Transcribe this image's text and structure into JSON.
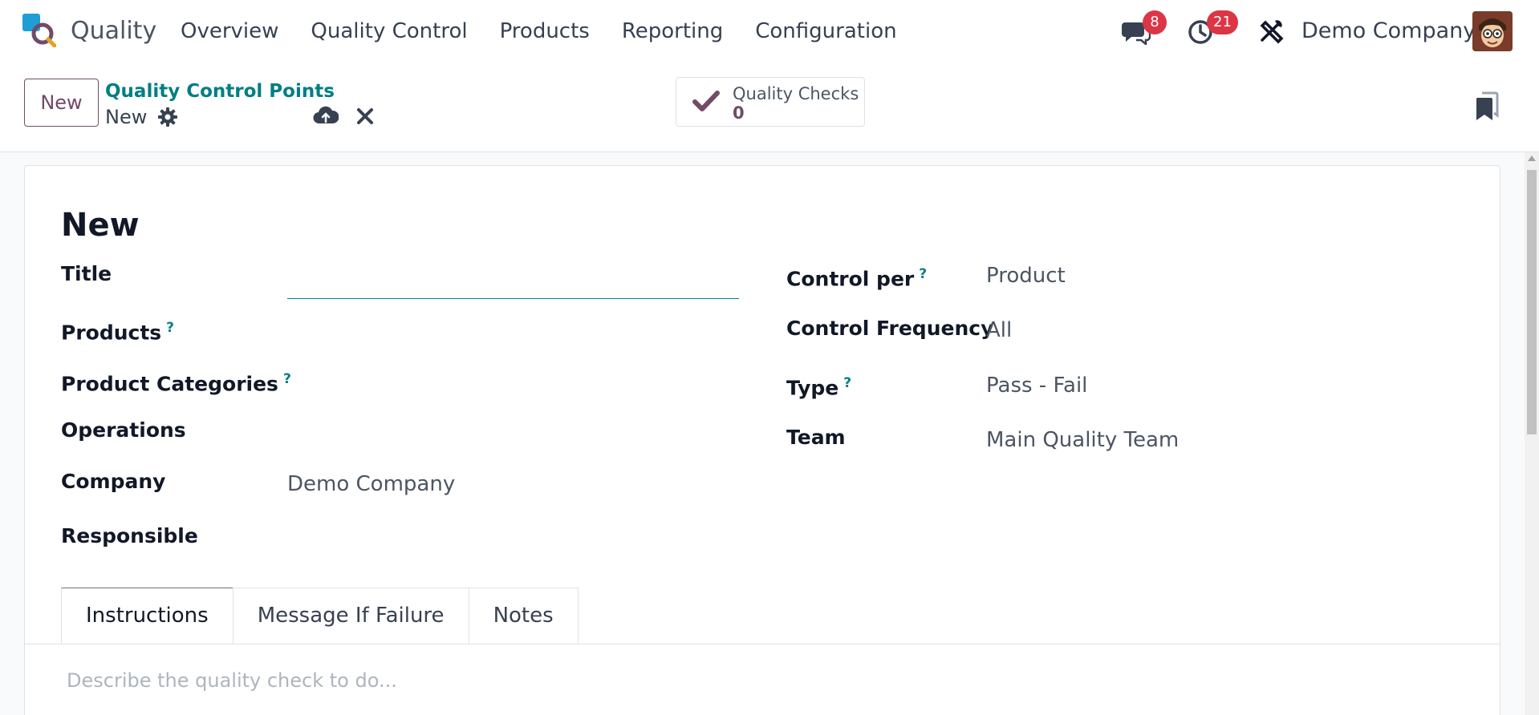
{
  "app": {
    "name": "Quality",
    "logo": "quality-app-logo"
  },
  "menu": {
    "items": [
      "Overview",
      "Quality Control",
      "Products",
      "Reporting",
      "Configuration"
    ]
  },
  "systray": {
    "messages_count": "8",
    "activities_count": "21",
    "company": "Demo Company",
    "badge_color": "#dc3545"
  },
  "control_panel": {
    "new_label": "New",
    "breadcrumb": "Quality Control Points",
    "record_name": "New"
  },
  "smart_button": {
    "label": "Quality Checks",
    "value": "0"
  },
  "form": {
    "title": "New",
    "left": {
      "title_label": "Title",
      "title_value": "",
      "products_label": "Products",
      "categories_label": "Product Categories",
      "operations_label": "Operations",
      "company_label": "Company",
      "company_value": "Demo Company",
      "responsible_label": "Responsible",
      "help_mark": "?"
    },
    "right": {
      "control_per_label": "Control per",
      "control_per_value": "Product",
      "frequency_label": "Control Frequency",
      "frequency_value": "All",
      "type_label": "Type",
      "type_value": "Pass - Fail",
      "team_label": "Team",
      "team_value": "Main Quality Team"
    },
    "tabs": [
      "Instructions",
      "Message If Failure",
      "Notes"
    ],
    "active_tab": "Instructions",
    "instructions_placeholder": "Describe the quality check to do..."
  },
  "colors": {
    "primary": "#714b67",
    "link": "#017e84"
  }
}
